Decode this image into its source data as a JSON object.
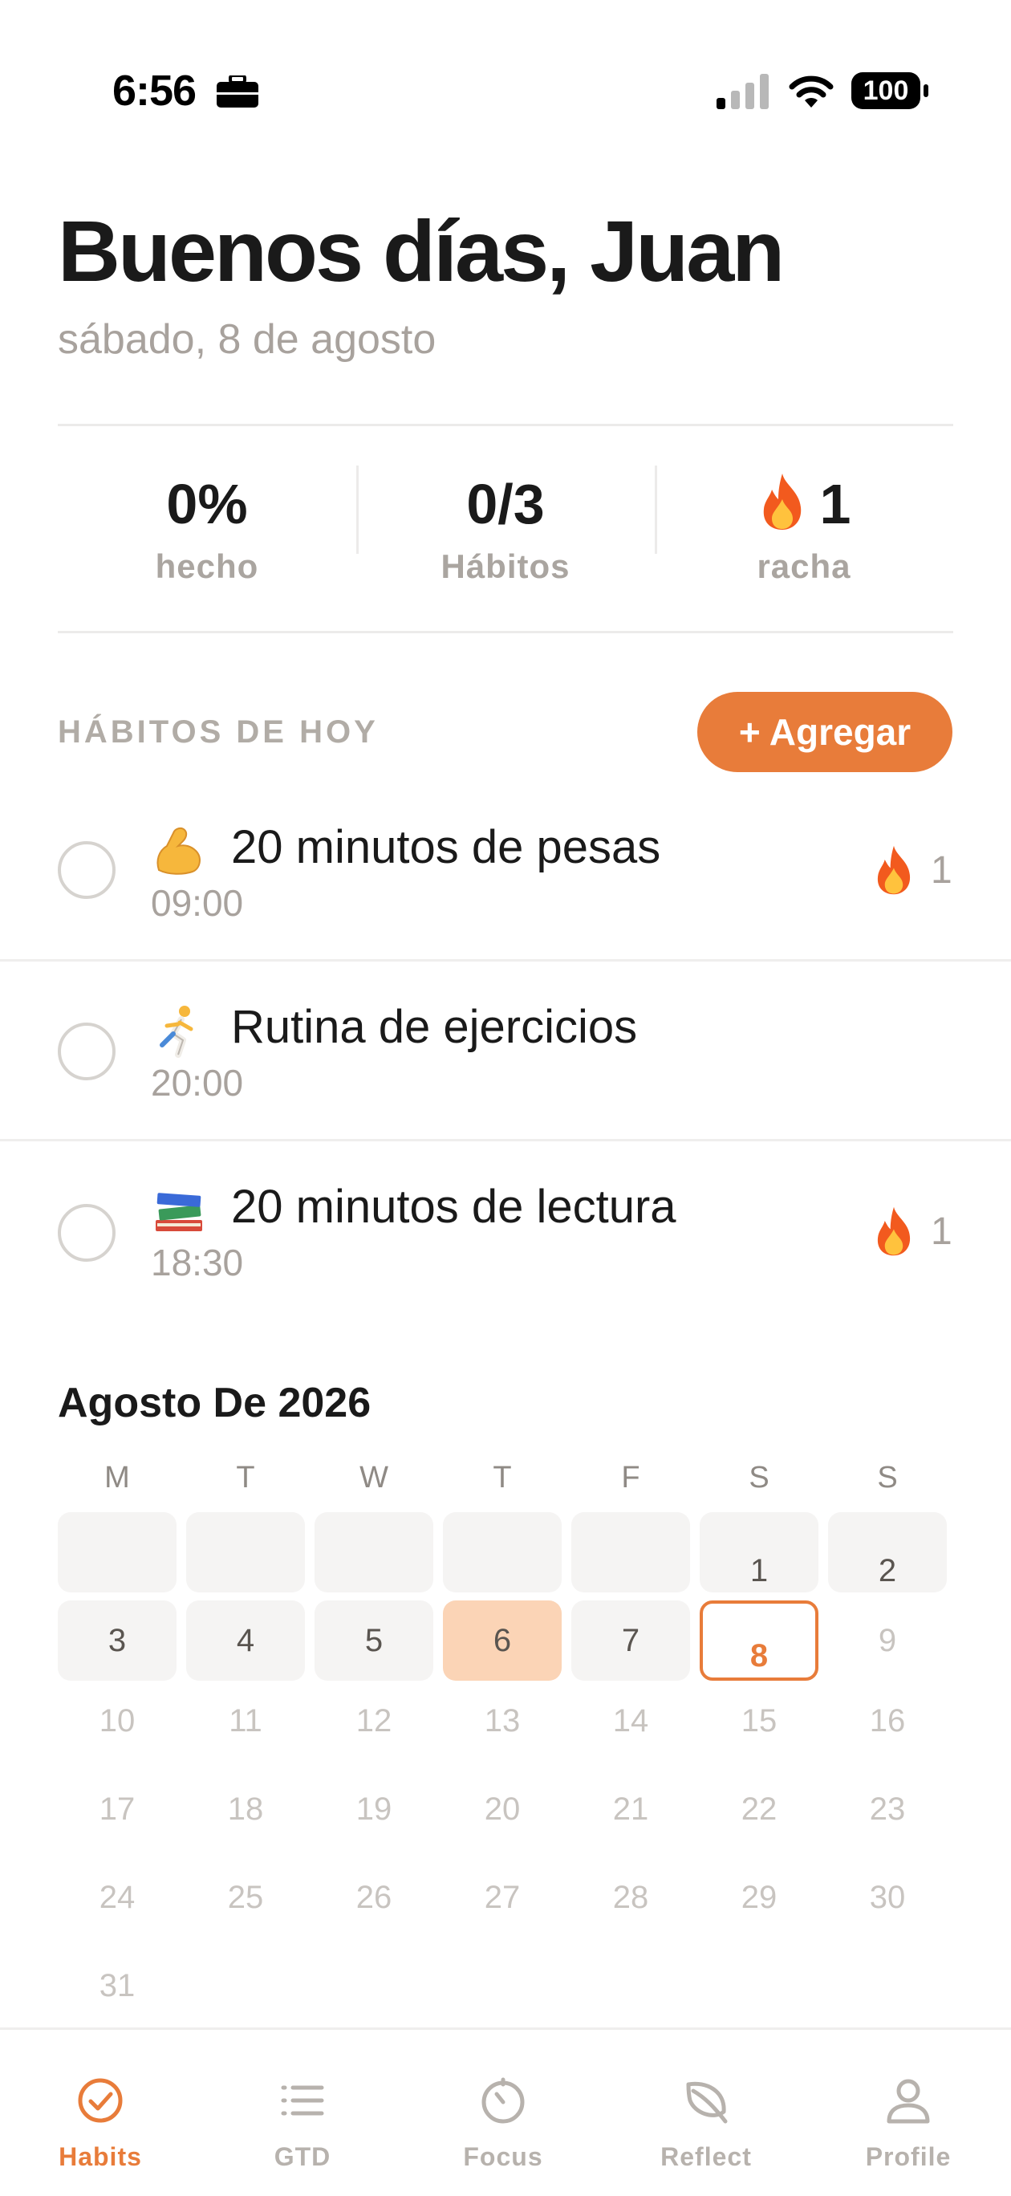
{
  "status_bar": {
    "time": "6:56",
    "battery": "100",
    "icons": [
      "briefcase-icon",
      "signal-icon",
      "wifi-icon",
      "battery-icon"
    ]
  },
  "header": {
    "greeting": "Buenos días, Juan",
    "date": "sábado, 8 de agosto"
  },
  "stats": [
    {
      "value": "0%",
      "label": "hecho"
    },
    {
      "value": "0/3",
      "label": "Hábitos"
    },
    {
      "value": "1",
      "label": "racha",
      "icon": "flame-icon"
    }
  ],
  "habits_section": {
    "title": "HÁBITOS DE HOY",
    "add_label": "+ Agregar"
  },
  "habits": [
    {
      "emoji": "💪",
      "name": "20 minutos de pesas",
      "time": "09:00",
      "streak": "1",
      "completed": false
    },
    {
      "emoji": "🏃",
      "name": "Rutina de ejercicios",
      "time": "20:00",
      "streak": "",
      "completed": false
    },
    {
      "emoji": "📚",
      "name": "20 minutos de lectura",
      "time": "18:30",
      "streak": "1",
      "completed": false
    }
  ],
  "calendar": {
    "title": "Agosto De 2026",
    "weekdays": [
      "M",
      "T",
      "W",
      "T",
      "F",
      "S",
      "S"
    ],
    "today": "8",
    "completed_days": [
      "6"
    ],
    "days": [
      "1",
      "2",
      "3",
      "4",
      "5",
      "6",
      "7",
      "8",
      "9",
      "10",
      "11",
      "12",
      "13",
      "14",
      "15",
      "16",
      "17",
      "18",
      "19",
      "20",
      "21",
      "22",
      "23",
      "24",
      "25",
      "26",
      "27",
      "28",
      "29",
      "30",
      "31"
    ],
    "colors": {
      "accent": "#e87c3a",
      "completed": "#fbd4b6",
      "past": "#f5f4f3"
    }
  },
  "tab_bar": {
    "tabs": [
      {
        "label": "Habits",
        "icon": "check-circle-icon",
        "active": true
      },
      {
        "label": "GTD",
        "icon": "list-icon",
        "active": false
      },
      {
        "label": "Focus",
        "icon": "timer-icon",
        "active": false
      },
      {
        "label": "Reflect",
        "icon": "leaf-icon",
        "active": false
      },
      {
        "label": "Profile",
        "icon": "person-icon",
        "active": false
      }
    ]
  }
}
